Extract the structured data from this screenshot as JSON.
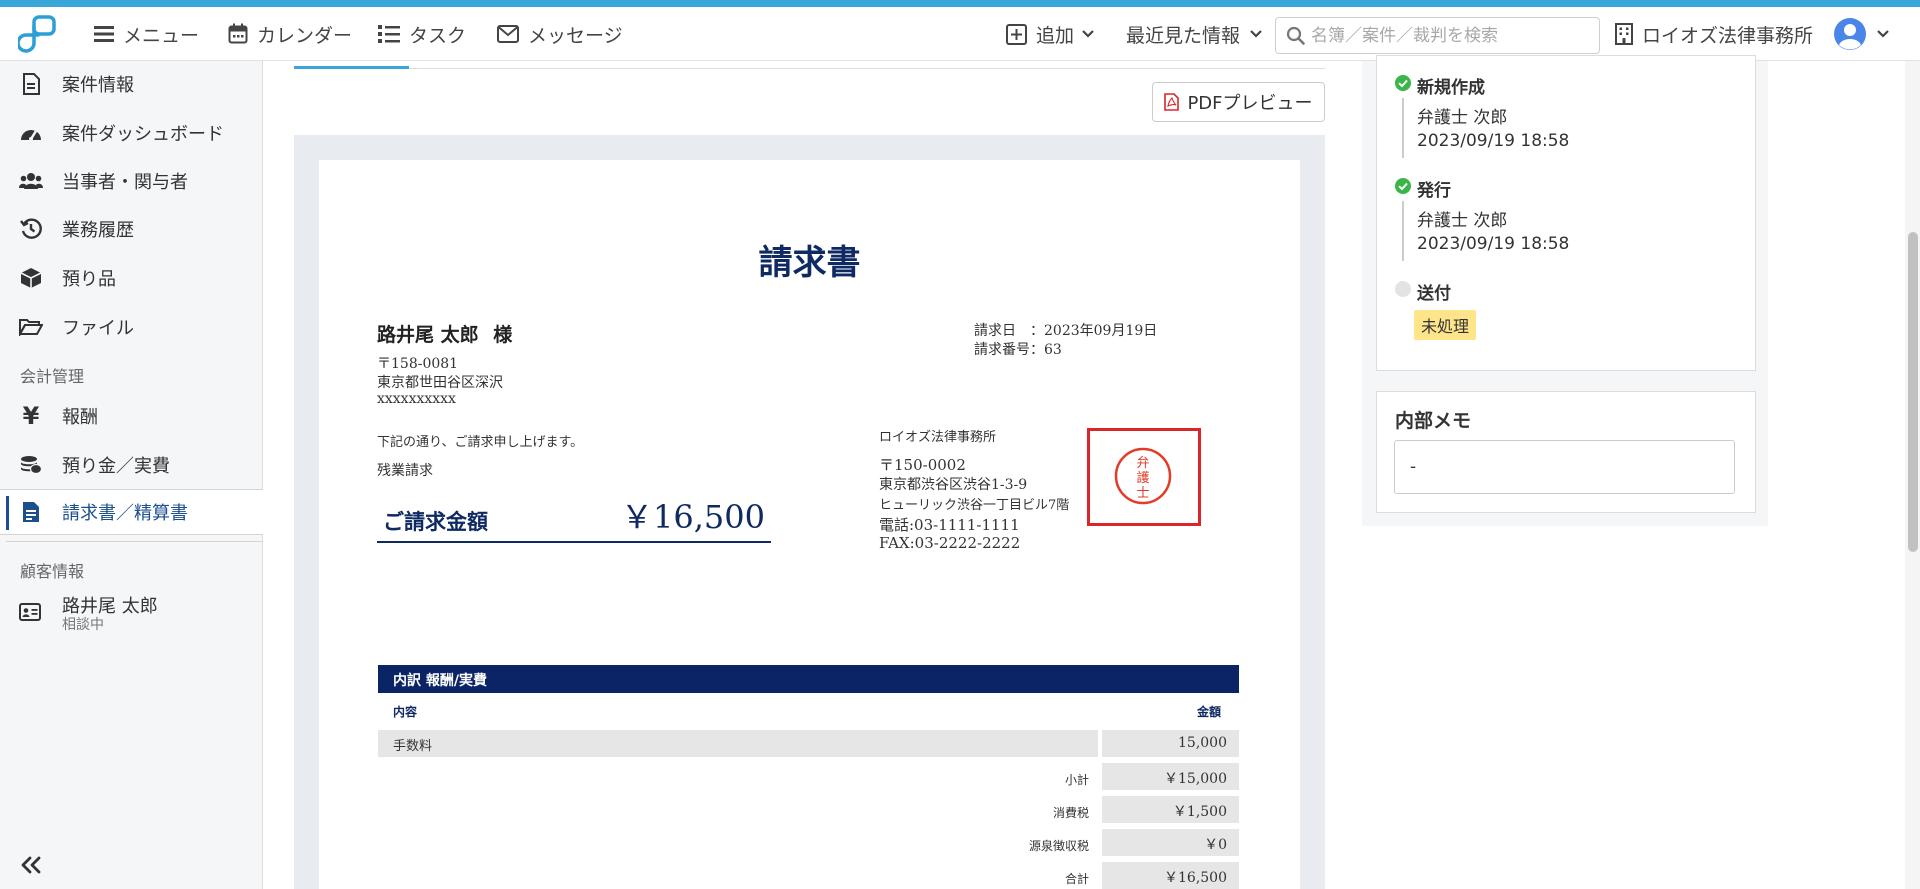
{
  "header": {
    "menu": "メニュー",
    "calendar": "カレンダー",
    "tasks": "タスク",
    "messages": "メッセージ",
    "add": "追加",
    "recent": "最近見た情報",
    "search_placeholder": "名簿／案件／裁判を検索",
    "office": "ロイオズ法律事務所"
  },
  "sidebar": {
    "items": [
      {
        "label": "案件情報",
        "icon": "document-icon"
      },
      {
        "label": "案件ダッシュボード",
        "icon": "dashboard-icon"
      },
      {
        "label": "当事者・関与者",
        "icon": "users-icon"
      },
      {
        "label": "業務履歴",
        "icon": "history-icon"
      },
      {
        "label": "預り品",
        "icon": "box-icon"
      },
      {
        "label": "ファイル",
        "icon": "folder-icon"
      }
    ],
    "accounting_section": "会計管理",
    "accounting_items": [
      {
        "label": "報酬",
        "icon": "yen-icon"
      },
      {
        "label": "預り金／実費",
        "icon": "coins-icon"
      },
      {
        "label": "請求書／精算書",
        "icon": "invoice-icon",
        "active": true
      }
    ],
    "customer_section": "顧客情報",
    "customer": {
      "name": "路井尾 太郎",
      "status": "相談中"
    },
    "collapse_icon": "double-chevron-left-icon"
  },
  "main": {
    "pdf_preview": "PDFプレビュー"
  },
  "invoice": {
    "title": "請求書",
    "recipient": "路井尾 太郎",
    "honorific": "様",
    "postal": "〒158-0081",
    "address": "東京都世田谷区深沢",
    "address2": "xxxxxxxxxx",
    "date_label": "請求日",
    "date_value": "2023年09月19日",
    "number_label": "請求番号",
    "number_value": "63",
    "intro": "下記の通り、ご請求申し上げます。",
    "subject": "残業請求",
    "amount_label": "ご請求金額",
    "amount": "￥16,500",
    "firm": {
      "name": "ロイオズ法律事務所",
      "postal": "〒150-0002",
      "address": "東京都渋谷区渋谷1-3-9",
      "building": "ヒューリック渋谷一丁目ビル7階",
      "tel": "電話:03-1111-1111",
      "fax": "FAX:03-2222-2222"
    },
    "seal_text": "弁護士",
    "breakdown": {
      "header": "内訳 報酬/実費",
      "col_content": "内容",
      "col_amount": "金額",
      "rows": [
        {
          "content": "手数料",
          "amount": "15,000"
        }
      ],
      "totals": [
        {
          "label": "小計",
          "value": "￥15,000"
        },
        {
          "label": "消費税",
          "value": "￥1,500"
        },
        {
          "label": "源泉徴収税",
          "value": "￥0"
        },
        {
          "label": "合計",
          "value": "￥16,500"
        }
      ]
    }
  },
  "history": {
    "events": [
      {
        "title": "新規作成",
        "user": "弁護士 次郎",
        "time": "2023/09/19 18:58",
        "done": true
      },
      {
        "title": "発行",
        "user": "弁護士 次郎",
        "time": "2023/09/19 18:58",
        "done": true
      },
      {
        "title": "送付",
        "badge": "未処理",
        "done": false
      }
    ]
  },
  "memo": {
    "title": "内部メモ",
    "value": "-"
  },
  "colors": {
    "accent": "#39a7d8",
    "navy": "#0f2a63",
    "table_header": "#0b2466",
    "check_green": "#3bb44a",
    "badge_yellow": "#ffe58a",
    "seal_red": "#d9262d"
  }
}
